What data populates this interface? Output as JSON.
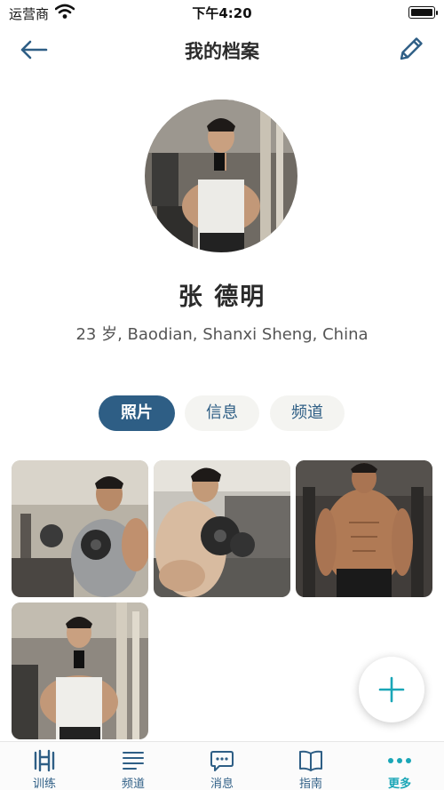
{
  "status_bar": {
    "carrier": "运营商",
    "time": "下午4:20",
    "wifi_icon": "wifi-icon",
    "battery_icon": "battery-icon"
  },
  "header": {
    "title": "我的档案",
    "back_icon": "arrow-left-icon",
    "edit_icon": "pencil-icon"
  },
  "profile": {
    "name": "张 德明",
    "meta": "23 岁, Baodian, Shanxi Sheng, China"
  },
  "tabs": [
    {
      "label": "照片",
      "active": true
    },
    {
      "label": "信息",
      "active": false
    },
    {
      "label": "频道",
      "active": false
    }
  ],
  "photos": [
    {
      "name": "photo-dumbbell-curl"
    },
    {
      "name": "photo-side-curl"
    },
    {
      "name": "photo-shirtless-pose"
    },
    {
      "name": "photo-gym-selfie"
    }
  ],
  "fab": {
    "icon": "plus-icon"
  },
  "bottom_nav": [
    {
      "label": "训练",
      "icon": "dumbbell-icon",
      "active": false
    },
    {
      "label": "频道",
      "icon": "list-icon",
      "active": false
    },
    {
      "label": "消息",
      "icon": "chat-icon",
      "active": false
    },
    {
      "label": "指南",
      "icon": "book-icon",
      "active": false
    },
    {
      "label": "更多",
      "icon": "more-dots-icon",
      "active": true
    }
  ],
  "colors": {
    "primary": "#2e5e85",
    "accent": "#1aa6b7",
    "tab_inactive_bg": "#f4f4f1"
  }
}
